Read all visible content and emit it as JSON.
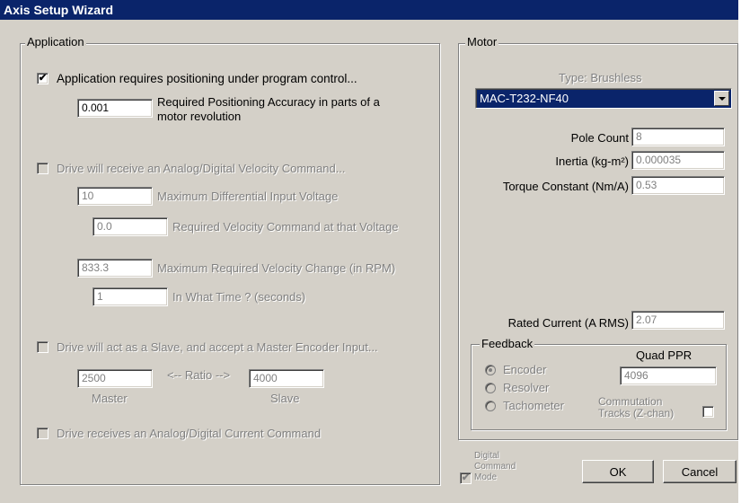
{
  "window": {
    "title": "Axis Setup Wizard"
  },
  "application": {
    "group_label": "Application",
    "positioning": {
      "checkbox_label": "Application requires positioning under program control...",
      "checked": true,
      "accuracy_value": "0.001",
      "accuracy_label_line1": "Required Positioning Accuracy in parts of a",
      "accuracy_label_line2": "motor revolution"
    },
    "velocity_command": {
      "checkbox_label": "Drive will receive an Analog/Digital Velocity Command...",
      "max_voltage_value": "10",
      "max_voltage_label": "Maximum Differential Input Voltage",
      "req_velocity_value": "0.0",
      "req_velocity_label": "Required Velocity Command at that Voltage",
      "max_change_value": "833.3",
      "max_change_label": "Maximum Required Velocity Change (in RPM)",
      "time_value": "1",
      "time_label": "In What Time ? (seconds)"
    },
    "slave": {
      "checkbox_label": "Drive will act as a Slave, and accept a Master Encoder Input...",
      "master_value": "2500",
      "ratio_label": "<-- Ratio -->",
      "slave_value": "4000",
      "master_label": "Master",
      "slave_label": "Slave"
    },
    "current_command": {
      "checkbox_label": "Drive receives an Analog/Digital Current Command"
    }
  },
  "motor": {
    "group_label": "Motor",
    "type_label": "Type: Brushless",
    "model_selected": "MAC-T232-NF40",
    "pole_count_label": "Pole Count",
    "pole_count_value": "8",
    "inertia_label": "Inertia (kg-m²)",
    "inertia_value": "0.000035",
    "torque_label": "Torque Constant (Nm/A)",
    "torque_value": "0.53",
    "rated_current_label": "Rated Current (A RMS)",
    "rated_current_value": "2.07",
    "feedback": {
      "group_label": "Feedback",
      "encoder_label": "Encoder",
      "resolver_label": "Resolver",
      "tachometer_label": "Tachometer",
      "quad_ppr_label": "Quad PPR",
      "quad_ppr_value": "4096",
      "commutation_line1": "Commutation",
      "commutation_line2": "Tracks (Z-chan)"
    }
  },
  "footer": {
    "digital_line1": "Digital",
    "digital_line2": "Command",
    "digital_line3": "Mode",
    "ok_label": "OK",
    "cancel_label": "Cancel"
  }
}
